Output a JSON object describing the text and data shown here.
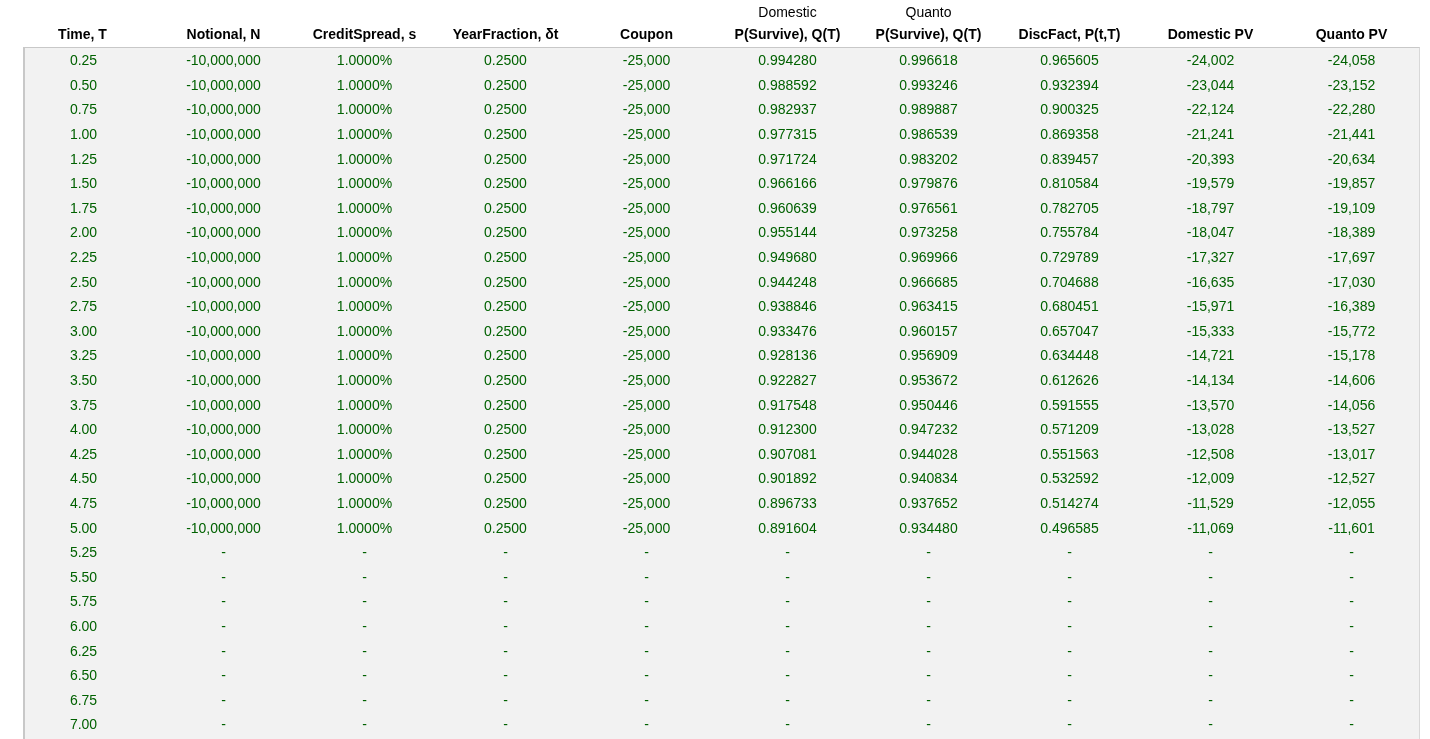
{
  "table": {
    "columns": [
      {
        "label": "Time, T"
      },
      {
        "label": "Notional, N"
      },
      {
        "label": "CreditSpread, s"
      },
      {
        "label": "YearFraction, δt"
      },
      {
        "label": "Coupon"
      },
      {
        "top": "Domestic",
        "label": "P(Survive), Q(T)"
      },
      {
        "top": "Quanto",
        "label": "P(Survive), Q(T)"
      },
      {
        "label": "DiscFact, P(t,T)"
      },
      {
        "label": "Domestic PV"
      },
      {
        "label": "Quanto PV"
      }
    ],
    "rows": [
      [
        "0.25",
        "-10,000,000",
        "1.0000%",
        "0.2500",
        "-25,000",
        "0.994280",
        "0.996618",
        "0.965605",
        "-24,002",
        "-24,058"
      ],
      [
        "0.50",
        "-10,000,000",
        "1.0000%",
        "0.2500",
        "-25,000",
        "0.988592",
        "0.993246",
        "0.932394",
        "-23,044",
        "-23,152"
      ],
      [
        "0.75",
        "-10,000,000",
        "1.0000%",
        "0.2500",
        "-25,000",
        "0.982937",
        "0.989887",
        "0.900325",
        "-22,124",
        "-22,280"
      ],
      [
        "1.00",
        "-10,000,000",
        "1.0000%",
        "0.2500",
        "-25,000",
        "0.977315",
        "0.986539",
        "0.869358",
        "-21,241",
        "-21,441"
      ],
      [
        "1.25",
        "-10,000,000",
        "1.0000%",
        "0.2500",
        "-25,000",
        "0.971724",
        "0.983202",
        "0.839457",
        "-20,393",
        "-20,634"
      ],
      [
        "1.50",
        "-10,000,000",
        "1.0000%",
        "0.2500",
        "-25,000",
        "0.966166",
        "0.979876",
        "0.810584",
        "-19,579",
        "-19,857"
      ],
      [
        "1.75",
        "-10,000,000",
        "1.0000%",
        "0.2500",
        "-25,000",
        "0.960639",
        "0.976561",
        "0.782705",
        "-18,797",
        "-19,109"
      ],
      [
        "2.00",
        "-10,000,000",
        "1.0000%",
        "0.2500",
        "-25,000",
        "0.955144",
        "0.973258",
        "0.755784",
        "-18,047",
        "-18,389"
      ],
      [
        "2.25",
        "-10,000,000",
        "1.0000%",
        "0.2500",
        "-25,000",
        "0.949680",
        "0.969966",
        "0.729789",
        "-17,327",
        "-17,697"
      ],
      [
        "2.50",
        "-10,000,000",
        "1.0000%",
        "0.2500",
        "-25,000",
        "0.944248",
        "0.966685",
        "0.704688",
        "-16,635",
        "-17,030"
      ],
      [
        "2.75",
        "-10,000,000",
        "1.0000%",
        "0.2500",
        "-25,000",
        "0.938846",
        "0.963415",
        "0.680451",
        "-15,971",
        "-16,389"
      ],
      [
        "3.00",
        "-10,000,000",
        "1.0000%",
        "0.2500",
        "-25,000",
        "0.933476",
        "0.960157",
        "0.657047",
        "-15,333",
        "-15,772"
      ],
      [
        "3.25",
        "-10,000,000",
        "1.0000%",
        "0.2500",
        "-25,000",
        "0.928136",
        "0.956909",
        "0.634448",
        "-14,721",
        "-15,178"
      ],
      [
        "3.50",
        "-10,000,000",
        "1.0000%",
        "0.2500",
        "-25,000",
        "0.922827",
        "0.953672",
        "0.612626",
        "-14,134",
        "-14,606"
      ],
      [
        "3.75",
        "-10,000,000",
        "1.0000%",
        "0.2500",
        "-25,000",
        "0.917548",
        "0.950446",
        "0.591555",
        "-13,570",
        "-14,056"
      ],
      [
        "4.00",
        "-10,000,000",
        "1.0000%",
        "0.2500",
        "-25,000",
        "0.912300",
        "0.947232",
        "0.571209",
        "-13,028",
        "-13,527"
      ],
      [
        "4.25",
        "-10,000,000",
        "1.0000%",
        "0.2500",
        "-25,000",
        "0.907081",
        "0.944028",
        "0.551563",
        "-12,508",
        "-13,017"
      ],
      [
        "4.50",
        "-10,000,000",
        "1.0000%",
        "0.2500",
        "-25,000",
        "0.901892",
        "0.940834",
        "0.532592",
        "-12,009",
        "-12,527"
      ],
      [
        "4.75",
        "-10,000,000",
        "1.0000%",
        "0.2500",
        "-25,000",
        "0.896733",
        "0.937652",
        "0.514274",
        "-11,529",
        "-12,055"
      ],
      [
        "5.00",
        "-10,000,000",
        "1.0000%",
        "0.2500",
        "-25,000",
        "0.891604",
        "0.934480",
        "0.496585",
        "-11,069",
        "-11,601"
      ],
      [
        "5.25",
        "-",
        "-",
        "-",
        "-",
        "-",
        "-",
        "-",
        "-",
        "-"
      ],
      [
        "5.50",
        "-",
        "-",
        "-",
        "-",
        "-",
        "-",
        "-",
        "-",
        "-"
      ],
      [
        "5.75",
        "-",
        "-",
        "-",
        "-",
        "-",
        "-",
        "-",
        "-",
        "-"
      ],
      [
        "6.00",
        "-",
        "-",
        "-",
        "-",
        "-",
        "-",
        "-",
        "-",
        "-"
      ],
      [
        "6.25",
        "-",
        "-",
        "-",
        "-",
        "-",
        "-",
        "-",
        "-",
        "-"
      ],
      [
        "6.50",
        "-",
        "-",
        "-",
        "-",
        "-",
        "-",
        "-",
        "-",
        "-"
      ],
      [
        "6.75",
        "-",
        "-",
        "-",
        "-",
        "-",
        "-",
        "-",
        "-",
        "-"
      ],
      [
        "7.00",
        "-",
        "-",
        "-",
        "-",
        "-",
        "-",
        "-",
        "-",
        "-"
      ]
    ]
  }
}
